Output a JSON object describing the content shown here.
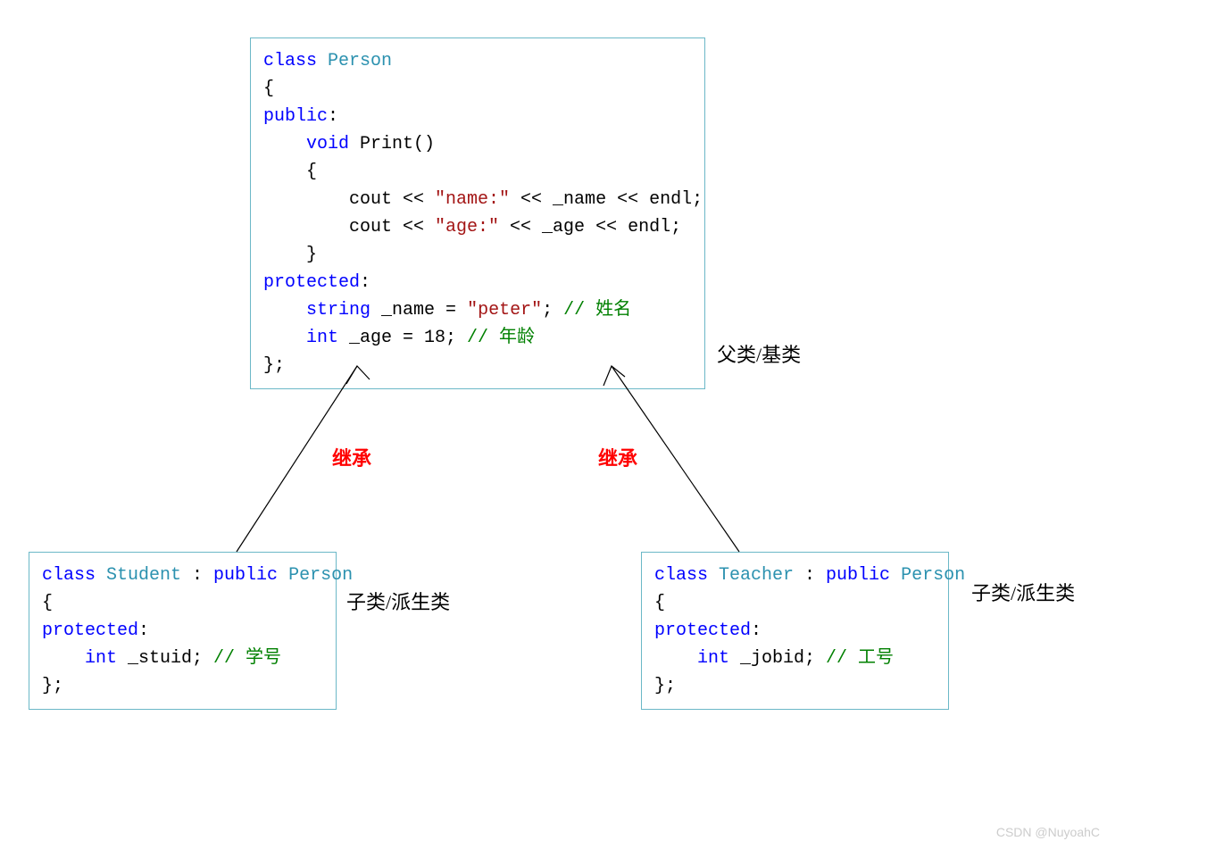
{
  "parent": {
    "l1_kw": "class",
    "l1_name": " Person",
    "l2": "{",
    "l3_kw": "public",
    "l3_colon": ":",
    "l4_kw": "    void",
    "l4_rest": " Print()",
    "l5": "    {",
    "l6_a": "        cout << ",
    "l6_str": "\"name:\"",
    "l6_b": " << _name << endl;",
    "l7_a": "        cout << ",
    "l7_str": "\"age:\"",
    "l7_b": " << _age << endl;",
    "l8": "    }",
    "l9_kw": "protected",
    "l9_colon": ":",
    "l10_kw": "    string",
    "l10_mid": " _name = ",
    "l10_str": "\"peter\"",
    "l10_end": "; ",
    "l10_comment": "// 姓名",
    "l11_kw": "    int",
    "l11_mid": " _age = 18; ",
    "l11_comment": "// 年龄",
    "l12": "};"
  },
  "student": {
    "l1_kw": "class",
    "l1_name": " Student",
    "l1_sep": " : ",
    "l1_pub": "public",
    "l1_base": " Person",
    "l2": "{",
    "l3_kw": "protected",
    "l3_colon": ":",
    "l4_kw": "    int",
    "l4_mid": " _stuid; ",
    "l4_comment": "// 学号",
    "l5": "};"
  },
  "teacher": {
    "l1_kw": "class",
    "l1_name": " Teacher",
    "l1_sep": " : ",
    "l1_pub": "public",
    "l1_base": " Person",
    "l2": "{",
    "l3_kw": "protected",
    "l3_colon": ":",
    "l4_kw": "    int",
    "l4_mid": " _jobid; ",
    "l4_comment": "// 工号",
    "l5": "};"
  },
  "labels": {
    "parentLabel": "父类/基类",
    "childLabel1": "子类/派生类",
    "childLabel2": "子类/派生类",
    "inherit1": "继承",
    "inherit2": "继承"
  },
  "watermark": "CSDN @NuyoahC"
}
